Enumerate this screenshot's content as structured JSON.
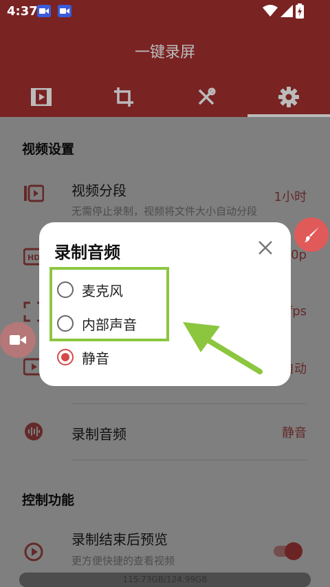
{
  "status_bar": {
    "time": "4:37"
  },
  "app": {
    "title": "一键录屏"
  },
  "tabs": [
    {
      "icon": "video-icon"
    },
    {
      "icon": "crop-icon"
    },
    {
      "icon": "tools-icon"
    },
    {
      "icon": "gear-icon",
      "selected": true
    }
  ],
  "sections": {
    "video_settings": "视频设置",
    "control_functions": "控制功能"
  },
  "rows": {
    "segment": {
      "title": "视频分段",
      "subtitle": "无需停止录制，视频将文件大小自动分段",
      "value": "1小时"
    },
    "resolution": {
      "value": "20p"
    },
    "fps": {
      "value": "fps"
    },
    "orientation": {
      "value": "自动"
    },
    "audio": {
      "title": "录制音频",
      "value": "静音"
    },
    "preview": {
      "title": "录制结束后预览",
      "subtitle": "更方便快捷的查看视频"
    }
  },
  "storage": {
    "text": "115.73GB/124.99GB"
  },
  "dialog": {
    "title": "录制音频",
    "options": [
      {
        "label": "麦克风",
        "selected": false
      },
      {
        "label": "内部声音",
        "selected": false
      },
      {
        "label": "静音",
        "selected": true
      }
    ]
  },
  "colors": {
    "primary": "#7a2323",
    "accent": "#d64848",
    "highlight": "#8cc63f"
  }
}
